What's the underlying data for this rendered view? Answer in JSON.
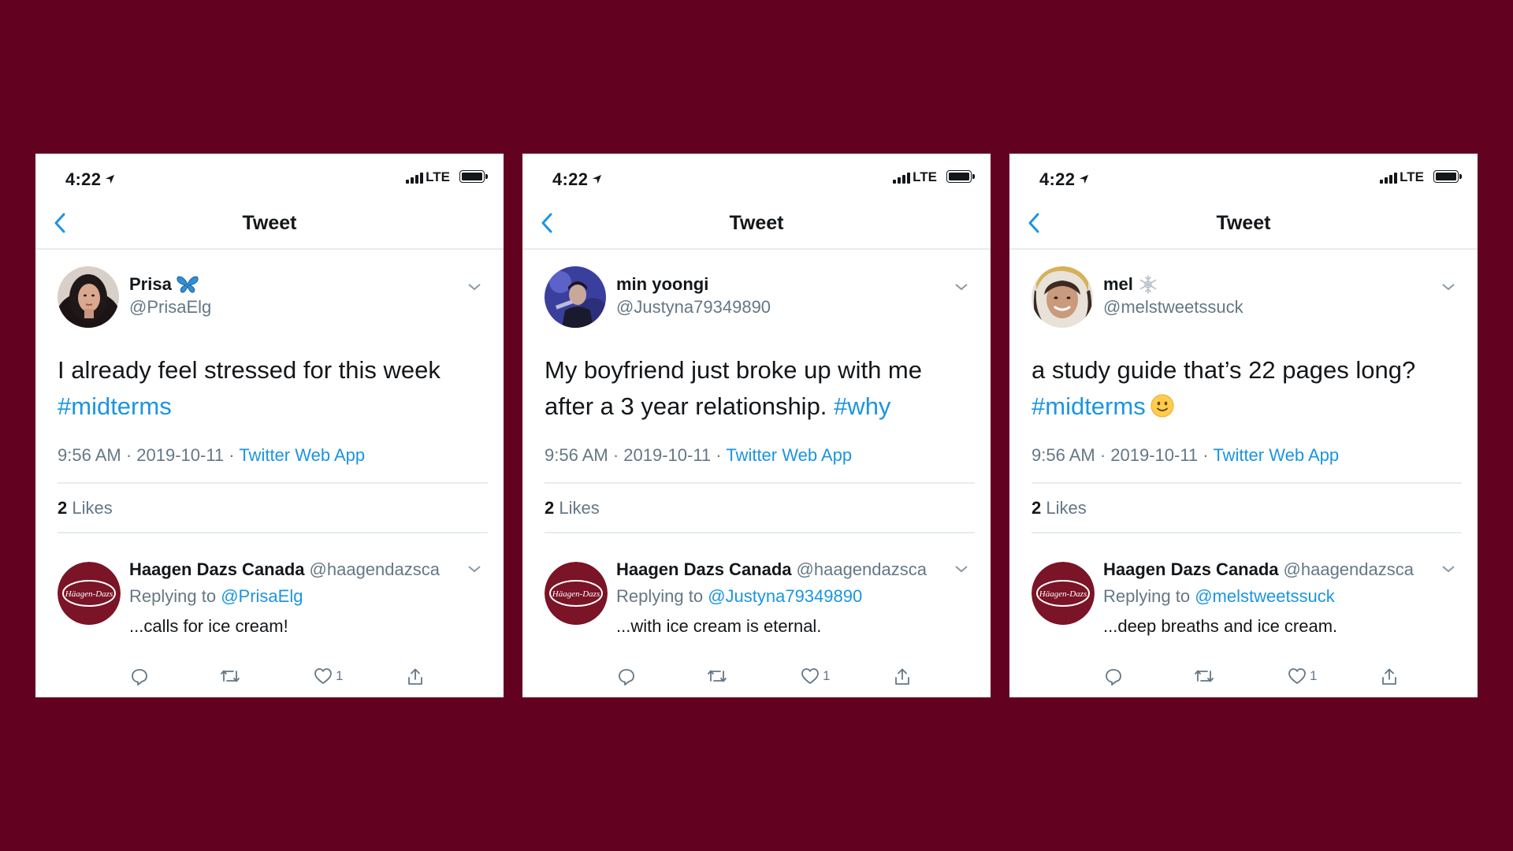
{
  "colors": {
    "background": "#630220",
    "accent": "#1b95e0",
    "secondary_text": "#657786",
    "brand_maroon": "#7a1426"
  },
  "cards": [
    {
      "status": {
        "time": "4:22",
        "network": "LTE"
      },
      "nav": {
        "title": "Tweet"
      },
      "author": {
        "name": "Prisa",
        "name_emoji": "butterfly",
        "handle": "@PrisaElg"
      },
      "tweet": {
        "text": "I already feel stressed for this week",
        "hashtag": "#midterms",
        "emoji": ""
      },
      "meta": {
        "time": "9:56 AM · 2019-10-11 · ",
        "source": "Twitter Web App"
      },
      "likes": {
        "count": "2",
        "label": "Likes"
      },
      "reply": {
        "name": "Haagen Dazs Canada",
        "handle": "@haagendazsca",
        "replying_prefix": "Replying to ",
        "replying_to": "@PrisaElg",
        "text": "...calls for ice cream!",
        "like_count": "1",
        "logo_text": "Häagen-Dazs"
      }
    },
    {
      "status": {
        "time": "4:22",
        "network": "LTE"
      },
      "nav": {
        "title": "Tweet"
      },
      "author": {
        "name": "min yoongi",
        "name_emoji": "",
        "handle": "@Justyna79349890"
      },
      "tweet": {
        "text": "My boyfriend just broke up with me after a 3 year relationship.",
        "hashtag": "#why",
        "emoji": ""
      },
      "meta": {
        "time": "9:56 AM · 2019-10-11 · ",
        "source": "Twitter Web App"
      },
      "likes": {
        "count": "2",
        "label": "Likes"
      },
      "reply": {
        "name": "Haagen Dazs Canada",
        "handle": "@haagendazsca",
        "replying_prefix": "Replying to ",
        "replying_to": "@Justyna79349890",
        "text": "...with ice cream is eternal.",
        "like_count": "1",
        "logo_text": "Häagen-Dazs"
      }
    },
    {
      "status": {
        "time": "4:22",
        "network": "LTE"
      },
      "nav": {
        "title": "Tweet"
      },
      "author": {
        "name": "mel",
        "name_emoji": "snowflake",
        "handle": "@melstweetssuck"
      },
      "tweet": {
        "text": "a study guide that’s 22 pages long?",
        "hashtag": "#midterms",
        "emoji": "slightly-smiling-face"
      },
      "meta": {
        "time": "9:56 AM · 2019-10-11 · ",
        "source": "Twitter Web App"
      },
      "likes": {
        "count": "2",
        "label": "Likes"
      },
      "reply": {
        "name": "Haagen Dazs Canada",
        "handle": "@haagendazsca",
        "replying_prefix": "Replying to ",
        "replying_to": "@melstweetssuck",
        "text": "...deep breaths and ice cream.",
        "like_count": "1",
        "logo_text": "Häagen-Dazs"
      }
    }
  ]
}
